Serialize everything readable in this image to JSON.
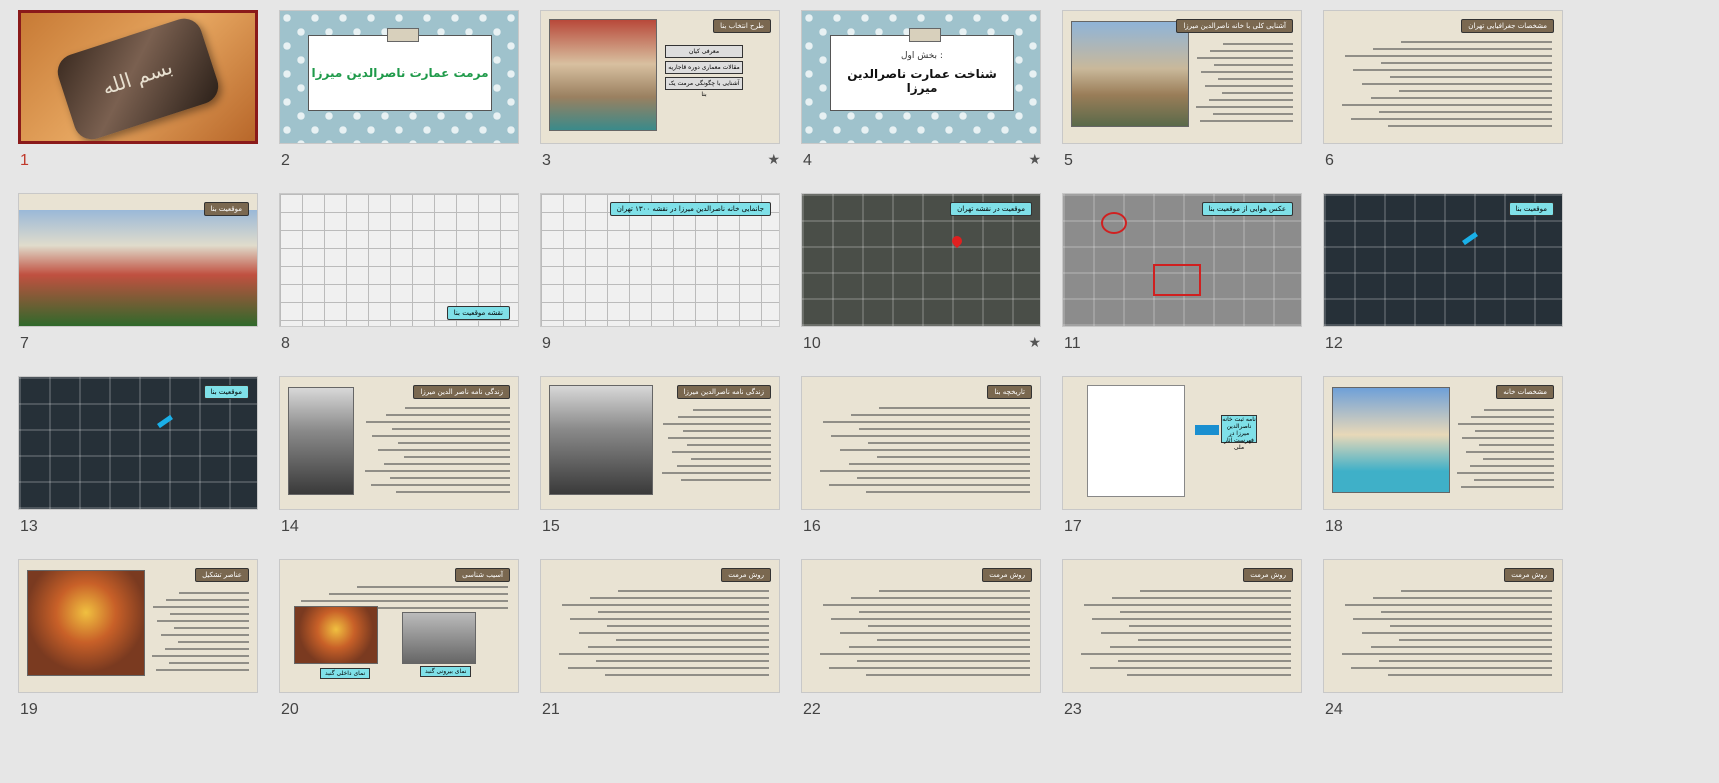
{
  "slides": [
    {
      "number": "1",
      "star": "",
      "title": "",
      "variant": "title-wood"
    },
    {
      "number": "2",
      "star": "",
      "title": "مرمت عمارت ناصرالدين ميرزا",
      "variant": "title-pattern"
    },
    {
      "number": "3",
      "star": "★",
      "title": "طرح انتخاب بنا",
      "variant": "menu",
      "menu": [
        "معرفی کیان",
        "مقالات معماری دوره قاجاریه",
        "آشنایی با چگونگی مرمت یک بنا"
      ]
    },
    {
      "number": "4",
      "star": "★",
      "title": "شناخت عمارت ناصرالدين ميرزا",
      "subtitle": "بخش اول :",
      "variant": "title-pattern"
    },
    {
      "number": "5",
      "star": "",
      "title": "آشنایی کلی با خانه ناصرالدین میرزا",
      "variant": "photo-text",
      "photo": "ph-palace"
    },
    {
      "number": "6",
      "star": "",
      "title": "مشخصات جغرافیایی تهران",
      "variant": "text"
    },
    {
      "number": "7",
      "star": "",
      "title": "موقعیت بنا",
      "variant": "facade"
    },
    {
      "number": "8",
      "star": "",
      "title": "نقشه موقعیت بنا",
      "variant": "map"
    },
    {
      "number": "9",
      "star": "",
      "title": "جانمایی خانه ناصرالدین میرزا در نقشه ۱۳۰۰ تهران",
      "variant": "map"
    },
    {
      "number": "10",
      "star": "★",
      "title": "موقعیت در نقشه تهران",
      "variant": "sat"
    },
    {
      "number": "11",
      "star": "",
      "title": "عکس هوایی از موقعیت بنا",
      "variant": "bw"
    },
    {
      "number": "12",
      "star": "",
      "title": "موقعیت بنا",
      "variant": "dark"
    },
    {
      "number": "13",
      "star": "",
      "title": "موقعیت بنا",
      "variant": "dark"
    },
    {
      "number": "14",
      "star": "",
      "title": "زندگی نامه ناصر الدین میرزا",
      "variant": "portrait"
    },
    {
      "number": "15",
      "star": "",
      "title": "زندگی نامه ناصرالدین میرزا",
      "variant": "portrait2"
    },
    {
      "number": "16",
      "star": "",
      "title": "تاریخچه بنا",
      "variant": "text"
    },
    {
      "number": "17",
      "star": "",
      "title": "",
      "variant": "doc"
    },
    {
      "number": "18",
      "star": "",
      "title": "مشخصات خانه",
      "variant": "photo-text",
      "photo": "ph-pool"
    },
    {
      "number": "19",
      "star": "",
      "title": "عناصر تشکیل",
      "variant": "photo-text",
      "photo": "ph-dome"
    },
    {
      "number": "20",
      "star": "",
      "title": "آسیب شناسی",
      "variant": "two-photos"
    },
    {
      "number": "21",
      "star": "",
      "title": "روش مرمت",
      "variant": "text"
    },
    {
      "number": "22",
      "star": "",
      "title": "روش مرمت",
      "variant": "text"
    },
    {
      "number": "23",
      "star": "",
      "title": "روش مرمت",
      "variant": "text"
    },
    {
      "number": "24",
      "star": "",
      "title": "روش مرمت",
      "variant": "text"
    }
  ],
  "ui": {
    "doc_label": "نامه ثبت خانه ناصرالدین میرزا در فهرست آثار ملی",
    "caption_a": "نمای داخلی گنبد",
    "caption_b": "نمای بیرونی گنبد"
  }
}
